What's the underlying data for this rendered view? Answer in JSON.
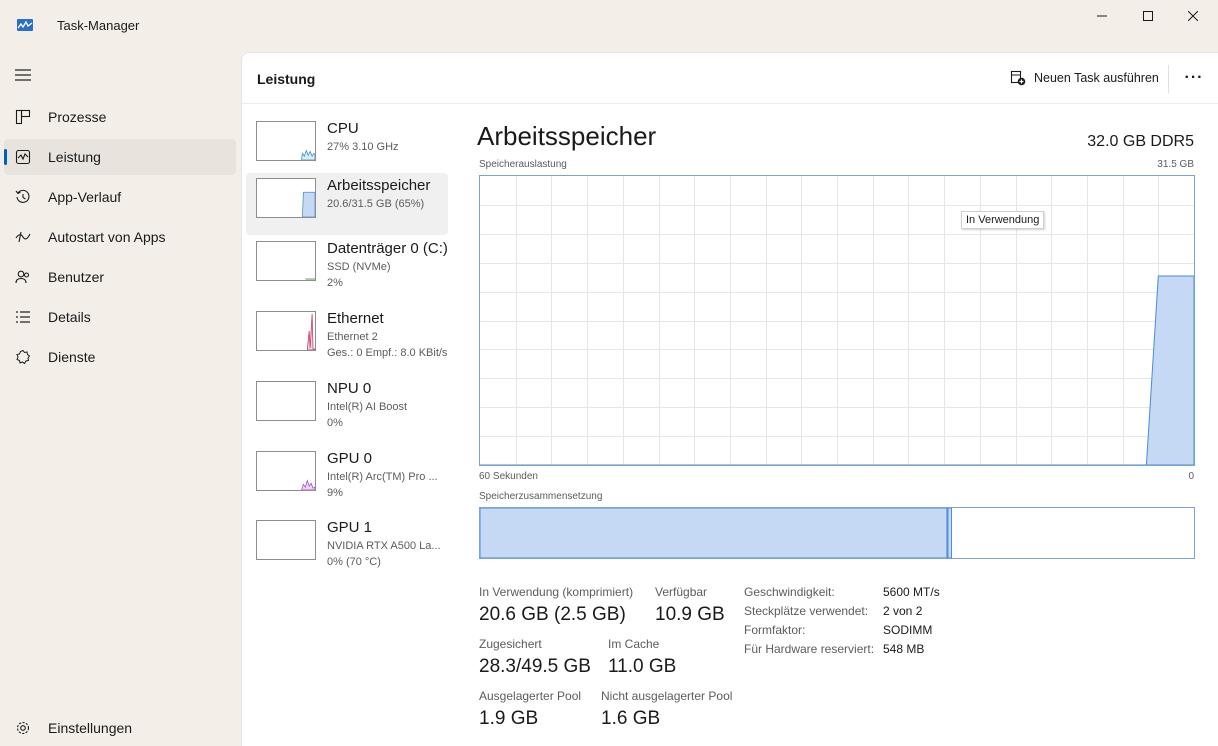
{
  "window": {
    "title": "Task-Manager",
    "controls": {
      "minimize": "—",
      "maximize": "☐",
      "close": "✕"
    }
  },
  "sidebar": {
    "items": [
      {
        "label": "Prozesse",
        "icon": "processes-icon"
      },
      {
        "label": "Leistung",
        "icon": "performance-icon",
        "active": true
      },
      {
        "label": "App-Verlauf",
        "icon": "history-icon"
      },
      {
        "label": "Autostart von Apps",
        "icon": "startup-icon"
      },
      {
        "label": "Benutzer",
        "icon": "users-icon"
      },
      {
        "label": "Details",
        "icon": "details-icon"
      },
      {
        "label": "Dienste",
        "icon": "services-icon"
      }
    ],
    "settings_label": "Einstellungen"
  },
  "header": {
    "title": "Leistung",
    "run_task_label": "Neuen Task ausführen",
    "more_label": "···"
  },
  "devices": [
    {
      "name": "CPU",
      "sub1": "27% 3.10 GHz",
      "sub2": ""
    },
    {
      "name": "Arbeitsspeicher",
      "sub1": "20.6/31.5 GB (65%)",
      "sub2": "",
      "active": true
    },
    {
      "name": "Datenträger 0 (C:)",
      "sub1": "SSD (NVMe)",
      "sub2": "2%"
    },
    {
      "name": "Ethernet",
      "sub1": "Ethernet 2",
      "sub2": "Ges.: 0 Empf.: 8.0 KBit/s"
    },
    {
      "name": "NPU 0",
      "sub1": "Intel(R) AI Boost",
      "sub2": "0%"
    },
    {
      "name": "GPU 0",
      "sub1": "Intel(R) Arc(TM) Pro ...",
      "sub2": "9%"
    },
    {
      "name": "GPU 1",
      "sub1": "NVIDIA RTX A500 La...",
      "sub2": "0% (70 °C)"
    }
  ],
  "memory": {
    "title": "Arbeitsspeicher",
    "spec": "32.0 GB DDR5",
    "usage_label": "Speicherauslastung",
    "max_label": "31.5 GB",
    "time_label": "60 Sekunden",
    "zero_label": "0",
    "tooltip": "In Verwendung",
    "composition_label": "Speicherzusammensetzung",
    "composition": {
      "in_use_fraction": 0.654,
      "modified_fraction": 0.005
    },
    "stats": {
      "in_use": {
        "label": "In Verwendung (komprimiert)",
        "value": "20.6 GB (2.5 GB)"
      },
      "available": {
        "label": "Verfügbar",
        "value": "10.9 GB"
      },
      "committed": {
        "label": "Zugesichert",
        "value": "28.3/49.5 GB"
      },
      "cached": {
        "label": "Im Cache",
        "value": "11.0 GB"
      },
      "paged_pool": {
        "label": "Ausgelagerter Pool",
        "value": "1.9 GB"
      },
      "nonpaged_pool": {
        "label": "Nicht ausgelagerter Pool",
        "value": "1.6 GB"
      }
    },
    "details": [
      {
        "label": "Geschwindigkeit:",
        "value": "5600 MT/s"
      },
      {
        "label": "Steckplätze verwendet:",
        "value": "2 von 2"
      },
      {
        "label": "Formfaktor:",
        "value": "SODIMM"
      },
      {
        "label": "Für Hardware reserviert:",
        "value": "548 MB"
      }
    ]
  },
  "chart_data": {
    "type": "area",
    "title": "Speicherauslastung",
    "xlabel": "",
    "ylabel": "",
    "x_range_labels": [
      "60 Sekunden",
      "0"
    ],
    "ylim": [
      0,
      31.5
    ],
    "unit": "GB",
    "series": [
      {
        "name": "In Verwendung",
        "x": [
          60,
          4,
          3,
          0
        ],
        "values": [
          0,
          0,
          20.6,
          20.6
        ]
      }
    ],
    "grid": true,
    "colors": {
      "fill": "#c5d9f5",
      "stroke": "#4a8bd8",
      "grid": "#e6e6e6"
    }
  },
  "colors": {
    "accent": "#005fb8",
    "memory": "#4a8bd8",
    "memory_fill": "#c5d9f5",
    "ethernet": "#c0396b",
    "gpu": "#a349c7",
    "disk": "#5a9a3a",
    "cpu": "#3b8fc4"
  }
}
